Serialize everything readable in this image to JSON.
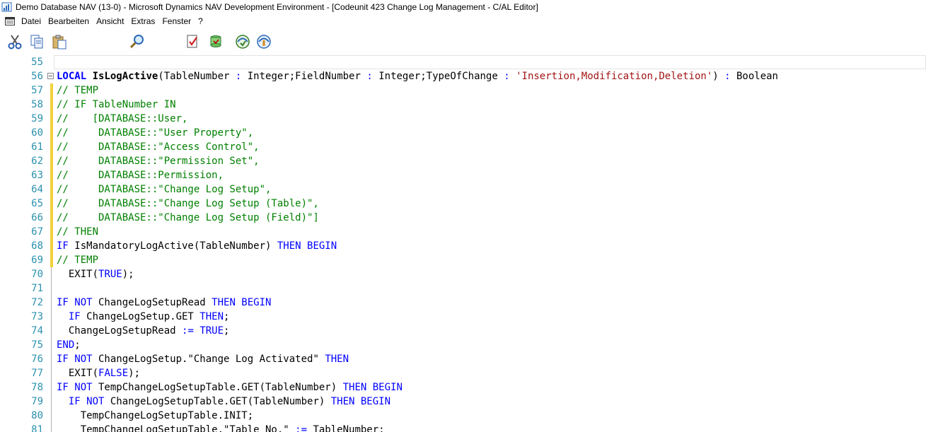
{
  "window": {
    "title": "Demo Database NAV (13-0) - Microsoft Dynamics NAV Development Environment - [Codeunit 423 Change Log Management - C/AL Editor]"
  },
  "menu": {
    "items": [
      "Datei",
      "Bearbeiten",
      "Ansicht",
      "Extras",
      "Fenster",
      "?"
    ]
  },
  "toolbar": {
    "buttons": [
      "cut-icon",
      "copy-icon",
      "paste-icon",
      "find-icon",
      "compile-icon",
      "database-icon",
      "symbol-menu-icon",
      "help-icon"
    ]
  },
  "colors": {
    "keyword": "#0000ff",
    "comment": "#008000",
    "string": "#a31515",
    "line_number": "#2b91af",
    "change_bar": "#f1d23b"
  },
  "editor": {
    "lines": [
      {
        "num": "55",
        "bar": "",
        "fold": false,
        "tokens": []
      },
      {
        "num": "56",
        "bar": "",
        "fold": true,
        "tokens": [
          {
            "t": "kw bold",
            "v": "LOCAL"
          },
          {
            "t": "plain",
            "v": " "
          },
          {
            "t": "plain bold",
            "v": "IsLogActive"
          },
          {
            "t": "plain",
            "v": "(TableNumber "
          },
          {
            "t": "kw",
            "v": ":"
          },
          {
            "t": "plain",
            "v": " Integer;FieldNumber "
          },
          {
            "t": "kw",
            "v": ":"
          },
          {
            "t": "plain",
            "v": " Integer;TypeOfChange "
          },
          {
            "t": "kw",
            "v": ":"
          },
          {
            "t": "plain",
            "v": " "
          },
          {
            "t": "str",
            "v": "'Insertion,Modification,Deletion'"
          },
          {
            "t": "plain",
            "v": ") "
          },
          {
            "t": "kw",
            "v": ":"
          },
          {
            "t": "plain",
            "v": " Boolean"
          }
        ]
      },
      {
        "num": "57",
        "bar": "mod",
        "fold": false,
        "tokens": [
          {
            "t": "cm",
            "v": "// TEMP"
          }
        ]
      },
      {
        "num": "58",
        "bar": "mod",
        "fold": false,
        "tokens": [
          {
            "t": "cm",
            "v": "// IF TableNumber IN"
          }
        ]
      },
      {
        "num": "59",
        "bar": "mod",
        "fold": false,
        "tokens": [
          {
            "t": "cm",
            "v": "//    [DATABASE::User,"
          }
        ]
      },
      {
        "num": "60",
        "bar": "mod",
        "fold": false,
        "tokens": [
          {
            "t": "cm",
            "v": "//     DATABASE::\"User Property\","
          }
        ]
      },
      {
        "num": "61",
        "bar": "mod",
        "fold": false,
        "tokens": [
          {
            "t": "cm",
            "v": "//     DATABASE::\"Access Control\","
          }
        ]
      },
      {
        "num": "62",
        "bar": "mod",
        "fold": false,
        "tokens": [
          {
            "t": "cm",
            "v": "//     DATABASE::\"Permission Set\","
          }
        ]
      },
      {
        "num": "63",
        "bar": "mod",
        "fold": false,
        "tokens": [
          {
            "t": "cm",
            "v": "//     DATABASE::Permission,"
          }
        ]
      },
      {
        "num": "64",
        "bar": "mod",
        "fold": false,
        "tokens": [
          {
            "t": "cm",
            "v": "//     DATABASE::\"Change Log Setup\","
          }
        ]
      },
      {
        "num": "65",
        "bar": "mod",
        "fold": false,
        "tokens": [
          {
            "t": "cm",
            "v": "//     DATABASE::\"Change Log Setup (Table)\","
          }
        ]
      },
      {
        "num": "66",
        "bar": "mod",
        "fold": false,
        "tokens": [
          {
            "t": "cm",
            "v": "//     DATABASE::\"Change Log Setup (Field)\"]"
          }
        ]
      },
      {
        "num": "67",
        "bar": "mod",
        "fold": false,
        "tokens": [
          {
            "t": "cm",
            "v": "// THEN"
          }
        ]
      },
      {
        "num": "68",
        "bar": "mod",
        "fold": false,
        "tokens": [
          {
            "t": "kw",
            "v": "IF"
          },
          {
            "t": "plain",
            "v": " IsMandatoryLogActive(TableNumber) "
          },
          {
            "t": "kw",
            "v": "THEN BEGIN"
          }
        ]
      },
      {
        "num": "69",
        "bar": "mod",
        "fold": false,
        "tokens": [
          {
            "t": "cm",
            "v": "// TEMP"
          }
        ]
      },
      {
        "num": "70",
        "bar": "",
        "fold": false,
        "tokens": [
          {
            "t": "plain",
            "v": "  EXIT("
          },
          {
            "t": "kw",
            "v": "TRUE"
          },
          {
            "t": "plain",
            "v": ");"
          }
        ]
      },
      {
        "num": "71",
        "bar": "",
        "fold": false,
        "tokens": []
      },
      {
        "num": "72",
        "bar": "",
        "fold": false,
        "tokens": [
          {
            "t": "kw",
            "v": "IF NOT"
          },
          {
            "t": "plain",
            "v": " ChangeLogSetupRead "
          },
          {
            "t": "kw",
            "v": "THEN BEGIN"
          }
        ]
      },
      {
        "num": "73",
        "bar": "",
        "fold": false,
        "tokens": [
          {
            "t": "plain",
            "v": "  "
          },
          {
            "t": "kw",
            "v": "IF"
          },
          {
            "t": "plain",
            "v": " ChangeLogSetup.GET "
          },
          {
            "t": "kw",
            "v": "THEN"
          },
          {
            "t": "plain",
            "v": ";"
          }
        ]
      },
      {
        "num": "74",
        "bar": "",
        "fold": false,
        "tokens": [
          {
            "t": "plain",
            "v": "  ChangeLogSetupRead "
          },
          {
            "t": "kw",
            "v": ":="
          },
          {
            "t": "plain",
            "v": " "
          },
          {
            "t": "kw",
            "v": "TRUE"
          },
          {
            "t": "plain",
            "v": ";"
          }
        ]
      },
      {
        "num": "75",
        "bar": "",
        "fold": false,
        "tokens": [
          {
            "t": "kw",
            "v": "END"
          },
          {
            "t": "plain",
            "v": ";"
          }
        ]
      },
      {
        "num": "76",
        "bar": "",
        "fold": false,
        "tokens": [
          {
            "t": "kw",
            "v": "IF NOT"
          },
          {
            "t": "plain",
            "v": " ChangeLogSetup.\"Change Log Activated\" "
          },
          {
            "t": "kw",
            "v": "THEN"
          }
        ]
      },
      {
        "num": "77",
        "bar": "",
        "fold": false,
        "tokens": [
          {
            "t": "plain",
            "v": "  EXIT("
          },
          {
            "t": "kw",
            "v": "FALSE"
          },
          {
            "t": "plain",
            "v": ");"
          }
        ]
      },
      {
        "num": "78",
        "bar": "",
        "fold": false,
        "tokens": [
          {
            "t": "kw",
            "v": "IF NOT"
          },
          {
            "t": "plain",
            "v": " TempChangeLogSetupTable.GET(TableNumber) "
          },
          {
            "t": "kw",
            "v": "THEN BEGIN"
          }
        ]
      },
      {
        "num": "79",
        "bar": "",
        "fold": false,
        "tokens": [
          {
            "t": "plain",
            "v": "  "
          },
          {
            "t": "kw",
            "v": "IF NOT"
          },
          {
            "t": "plain",
            "v": " ChangeLogSetupTable.GET(TableNumber) "
          },
          {
            "t": "kw",
            "v": "THEN BEGIN"
          }
        ]
      },
      {
        "num": "80",
        "bar": "",
        "fold": false,
        "tokens": [
          {
            "t": "plain",
            "v": "    TempChangeLogSetupTable.INIT;"
          }
        ]
      },
      {
        "num": "81",
        "bar": "",
        "fold": false,
        "tokens": [
          {
            "t": "plain",
            "v": "    TempChangeLogSetupTable.\"Table No.\" "
          },
          {
            "t": "kw",
            "v": ":="
          },
          {
            "t": "plain",
            "v": " TableNumber;"
          }
        ]
      }
    ]
  }
}
